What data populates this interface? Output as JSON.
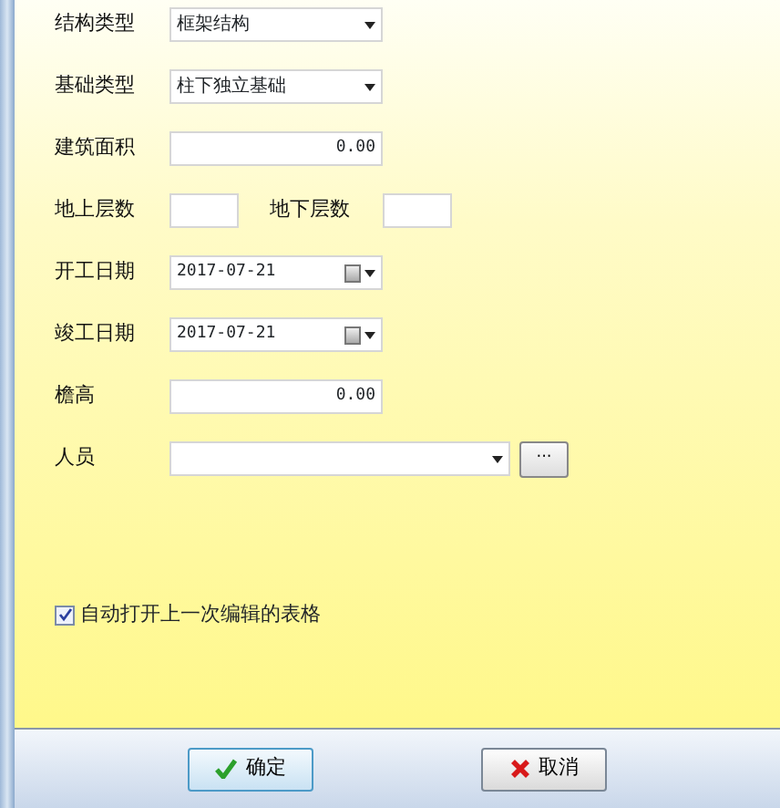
{
  "fields": [
    {
      "kind": "combo",
      "label": "结构类型",
      "value": "框架结构"
    },
    {
      "kind": "combo",
      "label": "基础类型",
      "value": "柱下独立基础"
    },
    {
      "kind": "number",
      "label": "建筑面积",
      "value": "0.00"
    },
    {
      "kind": "pair",
      "label": "地上层数",
      "label_2": "地下层数"
    },
    {
      "kind": "date",
      "label": "开工日期",
      "value": "2017-07-21"
    },
    {
      "kind": "date",
      "label": "竣工日期",
      "value": "2017-07-21"
    },
    {
      "kind": "number",
      "label": "檐高",
      "value": "0.00"
    },
    {
      "kind": "combo_button",
      "label": "人员",
      "button": "···"
    }
  ],
  "auto_open": {
    "label": "自动打开上一次编辑的表格",
    "checked": true
  },
  "buttons": [
    {
      "kind": "ok",
      "label": "确定"
    },
    {
      "kind": "cancel",
      "label": "取消"
    }
  ]
}
